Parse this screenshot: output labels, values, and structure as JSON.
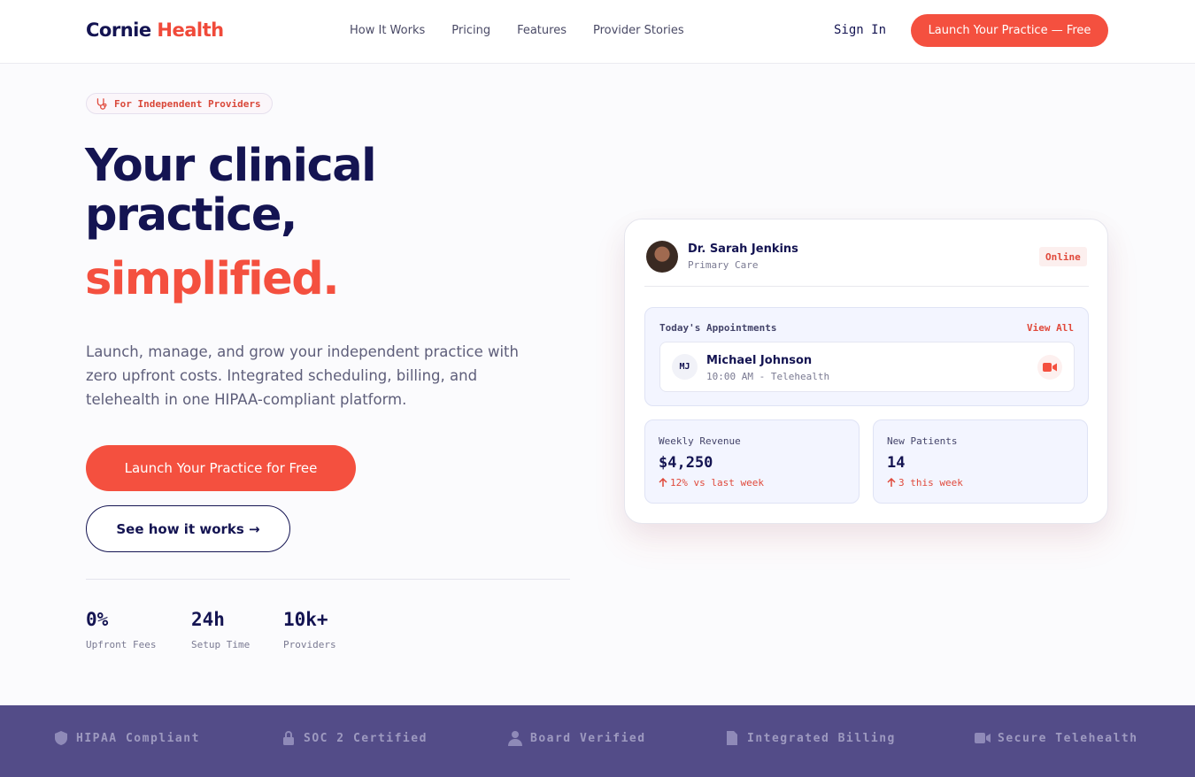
{
  "brand": {
    "part1": "Cornie",
    "part2": "Health"
  },
  "nav": {
    "items": [
      "How It Works",
      "Pricing",
      "Features",
      "Provider Stories"
    ],
    "sign_in": "Sign In",
    "cta": "Launch Your Practice — Free"
  },
  "hero": {
    "badge": "For Independent Providers",
    "title_line1": "Your clinical",
    "title_line2": "practice,",
    "title_accent": "simplified.",
    "lead": "Launch, manage, and grow your independent practice with zero upfront costs. Integrated scheduling, billing, and telehealth in one HIPAA-compliant platform.",
    "primary_cta": "Launch Your Practice for Free",
    "secondary_cta": "See how it works →",
    "stats": [
      {
        "value": "0%",
        "label": "Upfront Fees"
      },
      {
        "value": "24h",
        "label": "Setup Time"
      },
      {
        "value": "10k+",
        "label": "Providers"
      }
    ]
  },
  "card": {
    "doctor_name": "Dr. Sarah Jenkins",
    "doctor_role": "Primary Care",
    "status": "Online",
    "appointments_title": "Today's Appointments",
    "view_all": "View All",
    "appointment": {
      "initials": "MJ",
      "name": "Michael Johnson",
      "time": "10:00 AM - Telehealth"
    },
    "metrics": [
      {
        "title": "Weekly Revenue",
        "value": "$4,250",
        "delta": "12% vs last week"
      },
      {
        "title": "New Patients",
        "value": "14",
        "delta": "3 this week"
      }
    ]
  },
  "trust": [
    "HIPAA Compliant",
    "SOC 2 Certified",
    "Board Verified",
    "Integrated Billing",
    "Secure Telehealth"
  ],
  "colors": {
    "accent": "#f4503f",
    "navy": "#141452",
    "band": "#534c88"
  }
}
